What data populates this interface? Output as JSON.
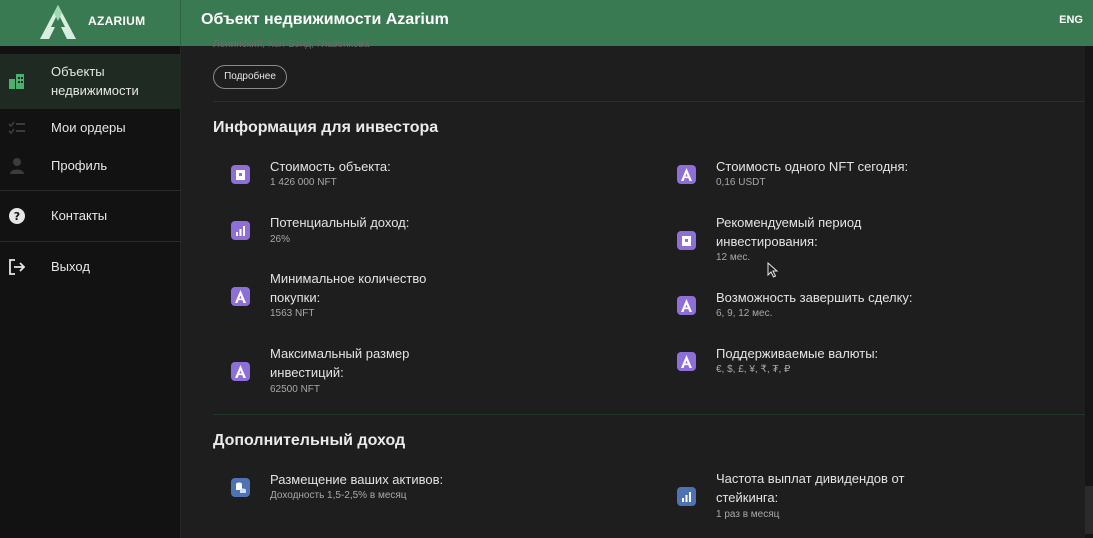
{
  "header": {
    "brand": "AZARIUM",
    "title": "Объект недвижимости Azarium",
    "lang": "ENG"
  },
  "sidebar": {
    "items": [
      {
        "label_line1": "Объекты",
        "label_line2": "недвижимости",
        "icon": "buildings-icon",
        "active": true
      },
      {
        "label": "Мои ордеры",
        "icon": "list-check-icon"
      },
      {
        "label": "Профиль",
        "icon": "user-icon"
      },
      {
        "label": "Контакты",
        "icon": "question-icon"
      },
      {
        "label": "Выход",
        "icon": "logout-icon"
      }
    ]
  },
  "main": {
    "cut_text": "Ленинский, Кол-Бэнд, Глазенкова",
    "more_label": "Подробнее",
    "investor": {
      "title": "Информация для инвестора",
      "left": [
        {
          "title_lines": [
            "Стоимость объекта:"
          ],
          "value": "1 426 000 NFT",
          "icon": "building-icon"
        },
        {
          "title_lines": [
            "Потенциальный доход:"
          ],
          "value": "26%",
          "icon": "bar-chart-icon"
        },
        {
          "title_lines": [
            "Минимальное количество",
            "покупки:"
          ],
          "value": "1563 NFT",
          "icon": "azarium-a-icon"
        },
        {
          "title_lines": [
            "Максимальный размер",
            "инвестиций:"
          ],
          "value": "62500 NFT",
          "icon": "azarium-a-icon"
        }
      ],
      "right": [
        {
          "title_lines": [
            "Стоимость одного NFT сегодня:"
          ],
          "value": "0,16 USDT",
          "icon": "azarium-a-icon"
        },
        {
          "title_lines": [
            "Рекомендуемый период",
            "инвестирования:"
          ],
          "value": "12 мес.",
          "icon": "building-icon"
        },
        {
          "title_lines": [
            "Возможность завершить сделку:"
          ],
          "value": "6, 9, 12 мес.",
          "icon": "azarium-a-icon"
        },
        {
          "title_lines": [
            "Поддерживаемые валюты:"
          ],
          "value": "€, $, £, ¥, ₹, ₮, ₽",
          "icon": "azarium-a-icon"
        }
      ]
    },
    "extra": {
      "title": "Дополнительный доход",
      "left": [
        {
          "title_lines": [
            "Размещение ваших активов:"
          ],
          "value": "Доходность 1,5-2,5% в месяц",
          "icon": "coins-icon"
        }
      ],
      "right": [
        {
          "title_lines": [
            "Частота выплат дивидендов от",
            "стейкинга:"
          ],
          "value": "1 раз в месяц",
          "icon": "bar-chart-icon"
        }
      ]
    }
  },
  "colors": {
    "header": "#3a7a52",
    "sidebar": "#121212",
    "main": "#1e1e1e",
    "icon_purple": "#8e6fd8",
    "icon_blue": "#4e73b3"
  }
}
